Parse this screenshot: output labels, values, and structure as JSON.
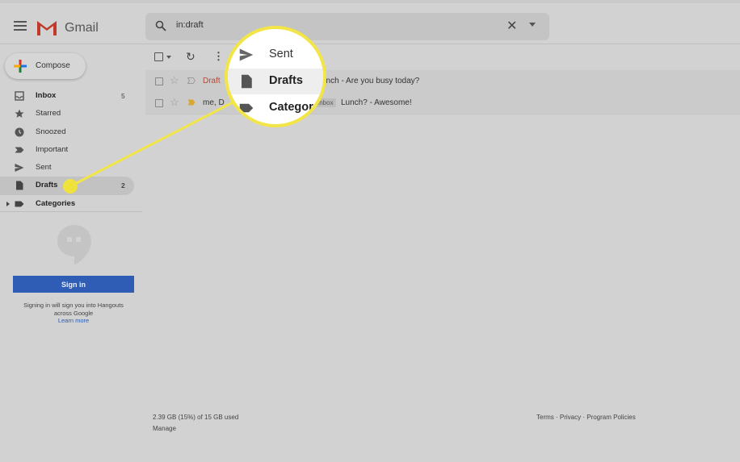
{
  "header": {
    "brand": "Gmail",
    "search_value": "in:draft"
  },
  "compose": {
    "label": "Compose"
  },
  "sidebar": {
    "items": [
      {
        "label": "Inbox",
        "count": "5",
        "icon": "inbox-icon"
      },
      {
        "label": "Starred",
        "count": "",
        "icon": "star-icon"
      },
      {
        "label": "Snoozed",
        "count": "",
        "icon": "clock-icon"
      },
      {
        "label": "Important",
        "count": "",
        "icon": "important-icon"
      },
      {
        "label": "Sent",
        "count": "",
        "icon": "send-icon"
      },
      {
        "label": "Drafts",
        "count": "2",
        "icon": "draft-icon"
      },
      {
        "label": "Categories",
        "count": "",
        "icon": "label-icon"
      }
    ]
  },
  "hangouts": {
    "signin_label": "Sign in",
    "text_line1": "Signing in will sign you into Hangouts",
    "text_line2": "across Google",
    "learn_more": "Learn more"
  },
  "messages": [
    {
      "sender": "Draft",
      "snippet": "unch - Are you busy today?",
      "label": ""
    },
    {
      "sender": "me, D",
      "snippet": "Lunch? - Awesome!",
      "label": "Inbox"
    }
  ],
  "footer": {
    "storage": "2.39 GB (15%) of 15 GB used",
    "manage": "Manage",
    "links": "Terms · Privacy · Program Policies"
  },
  "magnifier": {
    "items": [
      {
        "label": "Sent",
        "icon": "send-icon"
      },
      {
        "label": "Drafts",
        "icon": "draft-icon"
      },
      {
        "label": "Categor",
        "icon": "label-icon"
      }
    ]
  },
  "colors": {
    "highlight": "#f2e548",
    "signin_button": "#2f5db5",
    "draft_sender": "#b04a3a"
  }
}
